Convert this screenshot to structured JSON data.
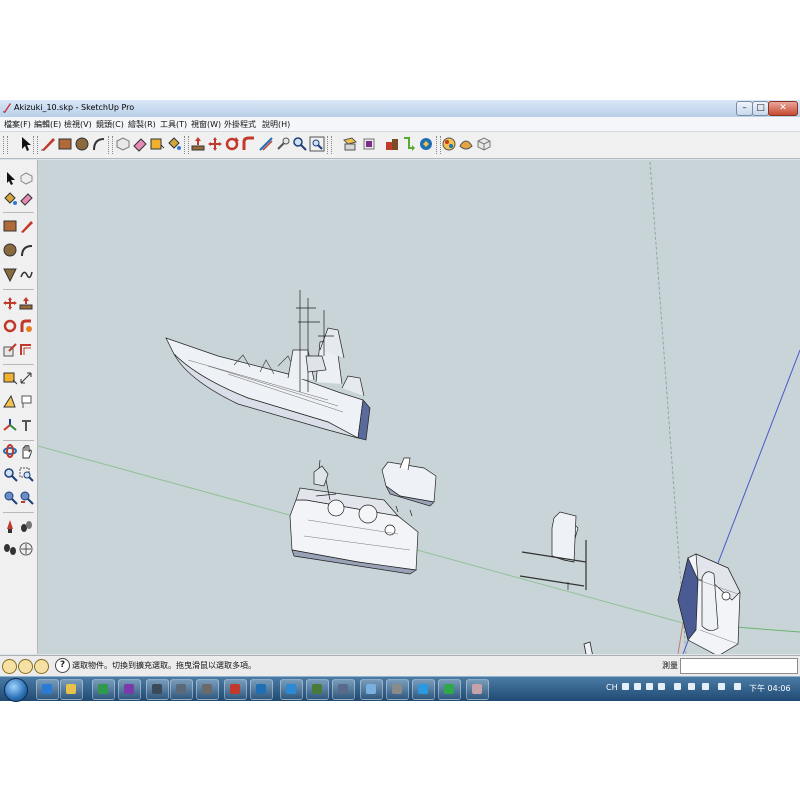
{
  "window": {
    "title": "Akizuki_10.skp - SketchUp Pro",
    "controls": {
      "minimize": "–",
      "maximize": "□",
      "close": "✕"
    }
  },
  "menubar": {
    "items": [
      "檔案(F)",
      "編輯(E)",
      "檢視(V)",
      "鏡頭(C)",
      "繪製(R)",
      "工具(T)",
      "視窗(W)",
      "外掛程式",
      "說明(H)"
    ]
  },
  "main_toolbar": {
    "tools": [
      "select-icon",
      "make-component-icon",
      "rectangle-icon",
      "line-icon",
      "arc-icon",
      "eraser-icon",
      "paint-bucket-icon",
      "push-pull-icon",
      "move-icon",
      "rotate-icon",
      "follow-me-icon",
      "scale-icon",
      "offset-icon",
      "tape-measure-icon",
      "dimension-icon",
      "protractor-icon",
      "text-icon",
      "axes-icon",
      "3d-text-icon",
      "orbit-icon",
      "pan-icon",
      "zoom-icon",
      "zoom-window-icon",
      "zoom-extents-icon",
      "previous-view-icon",
      "next-view-icon",
      "position-camera-icon",
      "walk-icon",
      "look-around-icon",
      "section-plane-icon",
      "get-models-icon",
      "share-model-icon",
      "share-component-icon",
      "extension-warehouse-icon"
    ]
  },
  "left_toolbar": {
    "tools": [
      "select-icon",
      "make-component-icon",
      "paint-bucket-icon",
      "eraser-icon",
      "rectangle-icon",
      "line-icon",
      "circle-icon",
      "arc-icon",
      "polygon-icon",
      "freehand-icon",
      "move-icon",
      "push-pull-icon",
      "rotate-icon",
      "follow-me-icon",
      "scale-icon",
      "offset-icon",
      "tape-measure-icon",
      "dimension-icon",
      "protractor-icon",
      "text-icon",
      "axes-icon",
      "3d-text-icon",
      "orbit-icon",
      "pan-icon",
      "zoom-icon",
      "zoom-window-icon",
      "zoom-extents-icon",
      "previous-view-icon",
      "position-camera-icon",
      "walk-icon",
      "look-around-icon",
      "section-plane-icon"
    ]
  },
  "statusbar": {
    "icons": [
      "geo-location-icon",
      "credits-icon",
      "user-icon"
    ],
    "help_icon": "?",
    "message": "選取物件。切換到擴充選取。拖曳滑鼠以選取多項。",
    "measurements_label": "測量",
    "measurements_value": ""
  },
  "taskbar": {
    "start_button": "start-orb",
    "pinned": [
      "ie-icon",
      "explorer-icon",
      "media-icon",
      "app-icon-1",
      "app-icon-2",
      "app-icon-3",
      "app-icon-4",
      "sketchup-icon",
      "app-icon-5",
      "app-icon-6",
      "app-icon-7",
      "app-icon-8",
      "app-icon-9",
      "app-icon-10",
      "app-icon-11",
      "app-icon-12",
      "app-icon-13",
      "app-icon-14",
      "app-icon-15",
      "app-icon-16"
    ],
    "tray_text": "CH",
    "clock": "下午 04:06"
  },
  "colors": {
    "viewport_bg": "#c9d4d8",
    "axis_red": "#c97a73",
    "axis_green": "#6bb56c",
    "axis_blue": "#4858c8",
    "model_shade": "#5a6a9a"
  }
}
